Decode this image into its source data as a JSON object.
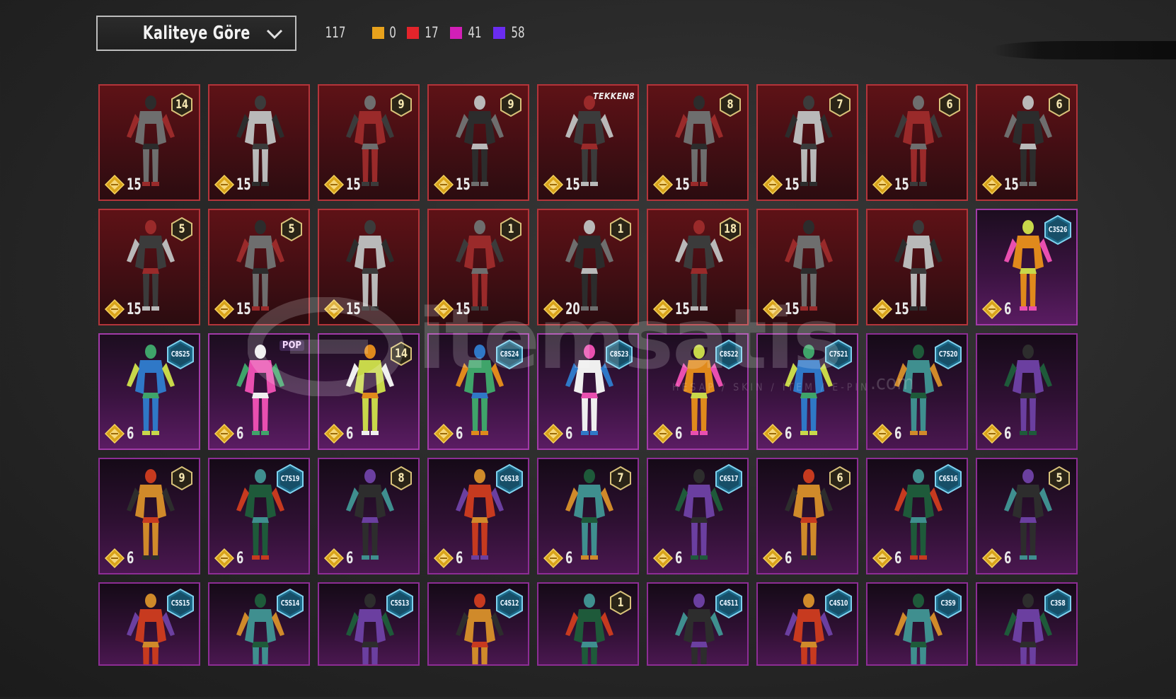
{
  "sort_dropdown": {
    "label": "Kaliteye Göre"
  },
  "counts": {
    "total": "117",
    "legendary": {
      "value": "0",
      "color": "#e8a21c"
    },
    "mythic": {
      "value": "17",
      "color": "#e3242b"
    },
    "epic": {
      "value": "41",
      "color": "#d21fb7"
    },
    "rare": {
      "value": "58",
      "color": "#6a2cf0"
    }
  },
  "watermark": {
    "brand": "itemsatis",
    "tagline": "HESAP / SKIN / ITEM / E-PIN",
    "suffix": ".com"
  },
  "rows": [
    [
      {
        "rarity": "red",
        "cost": "15",
        "badge": "14",
        "badge_type": "num"
      },
      {
        "rarity": "red",
        "cost": "15"
      },
      {
        "rarity": "red",
        "cost": "15",
        "badge": "9",
        "badge_type": "num"
      },
      {
        "rarity": "red",
        "cost": "15",
        "badge": "9",
        "badge_type": "num"
      },
      {
        "rarity": "red",
        "cost": "15",
        "badge": "TEKKEN8",
        "badge_type": "tekken"
      },
      {
        "rarity": "red",
        "cost": "15",
        "badge": "8",
        "badge_type": "num"
      },
      {
        "rarity": "red",
        "cost": "15",
        "badge": "7",
        "badge_type": "num"
      },
      {
        "rarity": "red",
        "cost": "15",
        "badge": "6",
        "badge_type": "num"
      },
      {
        "rarity": "red",
        "cost": "15",
        "badge": "6",
        "badge_type": "num"
      }
    ],
    [
      {
        "rarity": "red",
        "cost": "15",
        "badge": "5",
        "badge_type": "num"
      },
      {
        "rarity": "red",
        "cost": "15",
        "badge": "5",
        "badge_type": "num"
      },
      {
        "rarity": "red",
        "cost": "15"
      },
      {
        "rarity": "red",
        "cost": "15",
        "badge": "1",
        "badge_type": "num"
      },
      {
        "rarity": "red",
        "cost": "20",
        "badge": "1",
        "badge_type": "num"
      },
      {
        "rarity": "red",
        "cost": "15",
        "badge": "18",
        "badge_type": "num"
      },
      {
        "rarity": "red",
        "cost": "15"
      },
      {
        "rarity": "red",
        "cost": "15"
      },
      {
        "rarity": "purple",
        "cost": "6",
        "badge": "C3S26",
        "badge_type": "season"
      }
    ],
    [
      {
        "rarity": "purple",
        "cost": "6",
        "badge": "C8S25",
        "badge_type": "season"
      },
      {
        "rarity": "purple",
        "cost": "6",
        "badge": "POP",
        "badge_type": "pop"
      },
      {
        "rarity": "purple",
        "cost": "6",
        "badge": "14",
        "badge_type": "num"
      },
      {
        "rarity": "purple",
        "cost": "6",
        "badge": "C8S24",
        "badge_type": "season"
      },
      {
        "rarity": "purple",
        "cost": "6",
        "badge": "C8S23",
        "badge_type": "season"
      },
      {
        "rarity": "purple",
        "cost": "6",
        "badge": "C8S22",
        "badge_type": "season"
      },
      {
        "rarity": "purple",
        "cost": "6",
        "badge": "C7S21",
        "badge_type": "season"
      },
      {
        "rarity": "dark",
        "cost": "6",
        "badge": "C7S20",
        "badge_type": "season"
      },
      {
        "rarity": "dark",
        "cost": "6"
      }
    ],
    [
      {
        "rarity": "dark",
        "cost": "6",
        "badge": "9",
        "badge_type": "num"
      },
      {
        "rarity": "dark",
        "cost": "6",
        "badge": "C7S19",
        "badge_type": "season"
      },
      {
        "rarity": "dark",
        "cost": "6",
        "badge": "8",
        "badge_type": "num"
      },
      {
        "rarity": "dark",
        "cost": "6",
        "badge": "C6S18",
        "badge_type": "season"
      },
      {
        "rarity": "dark",
        "cost": "6",
        "badge": "7",
        "badge_type": "num"
      },
      {
        "rarity": "dark",
        "cost": "6",
        "badge": "C6S17",
        "badge_type": "season"
      },
      {
        "rarity": "dark",
        "cost": "6",
        "badge": "6",
        "badge_type": "num"
      },
      {
        "rarity": "dark",
        "cost": "6",
        "badge": "C6S16",
        "badge_type": "season"
      },
      {
        "rarity": "dark",
        "cost": "6",
        "badge": "5",
        "badge_type": "num"
      }
    ],
    [
      {
        "rarity": "dark",
        "badge": "C5S15",
        "badge_type": "season"
      },
      {
        "rarity": "dark",
        "badge": "C5S14",
        "badge_type": "season"
      },
      {
        "rarity": "dark",
        "badge": "C5S13",
        "badge_type": "season"
      },
      {
        "rarity": "dark",
        "badge": "C4S12",
        "badge_type": "season"
      },
      {
        "rarity": "dark",
        "badge": "1",
        "badge_type": "num"
      },
      {
        "rarity": "dark",
        "badge": "C4S11",
        "badge_type": "season"
      },
      {
        "rarity": "dark",
        "badge": "C4S10",
        "badge_type": "season"
      },
      {
        "rarity": "dark",
        "badge": "C3S9",
        "badge_type": "season"
      },
      {
        "rarity": "dark",
        "badge": "C3S8",
        "badge_type": "season"
      }
    ]
  ]
}
